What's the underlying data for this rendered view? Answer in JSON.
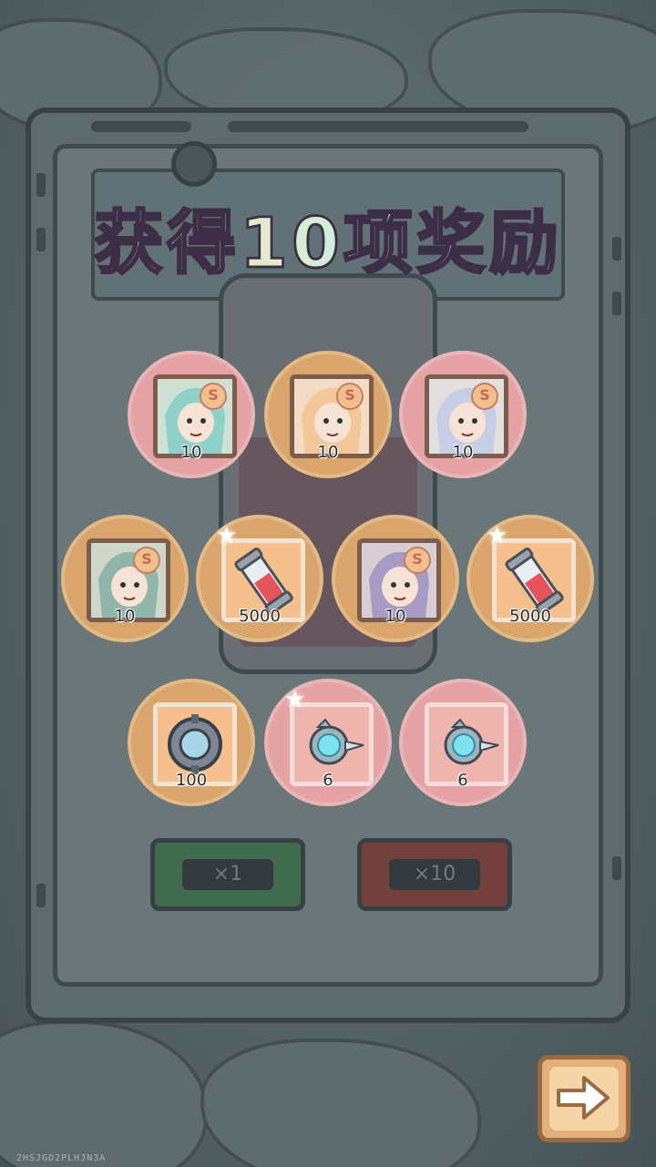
{
  "title": "获得10项奖励",
  "machine": {
    "button_single": "×1",
    "button_ten": "×10"
  },
  "rewards": [
    {
      "kind": "hero",
      "tier": "pink",
      "qty": "10",
      "icon": "hero-dragon-portrait-icon"
    },
    {
      "kind": "hero",
      "tier": "gold",
      "qty": "10",
      "icon": "hero-blonde-portrait-icon"
    },
    {
      "kind": "hero",
      "tier": "pink",
      "qty": "10",
      "icon": "hero-silver-hair-portrait-icon"
    },
    {
      "kind": "hero",
      "tier": "gold",
      "qty": "10",
      "icon": "hero-lizard-portrait-icon"
    },
    {
      "kind": "item",
      "tier": "gold",
      "qty": "5000",
      "icon": "red-potion-capsule-icon",
      "star": true
    },
    {
      "kind": "hero",
      "tier": "gold",
      "qty": "10",
      "icon": "hero-hooded-portrait-icon"
    },
    {
      "kind": "item",
      "tier": "gold",
      "qty": "5000",
      "icon": "red-potion-capsule-icon",
      "star": true
    },
    {
      "kind": "item",
      "tier": "gold",
      "qty": "100",
      "icon": "compass-device-icon"
    },
    {
      "kind": "item",
      "tier": "pink",
      "qty": "6",
      "icon": "cyan-orb-drone-icon",
      "star": true
    },
    {
      "kind": "item",
      "tier": "pink",
      "qty": "6",
      "icon": "cyan-orb-drone-icon"
    }
  ],
  "hero_badge": "S",
  "watermark": "2HSJGD2PLHJN3A",
  "colors": {
    "pink_tier": "#e6a3a6",
    "gold_tier": "#d9a56c",
    "next_button": "#e4b07a"
  }
}
